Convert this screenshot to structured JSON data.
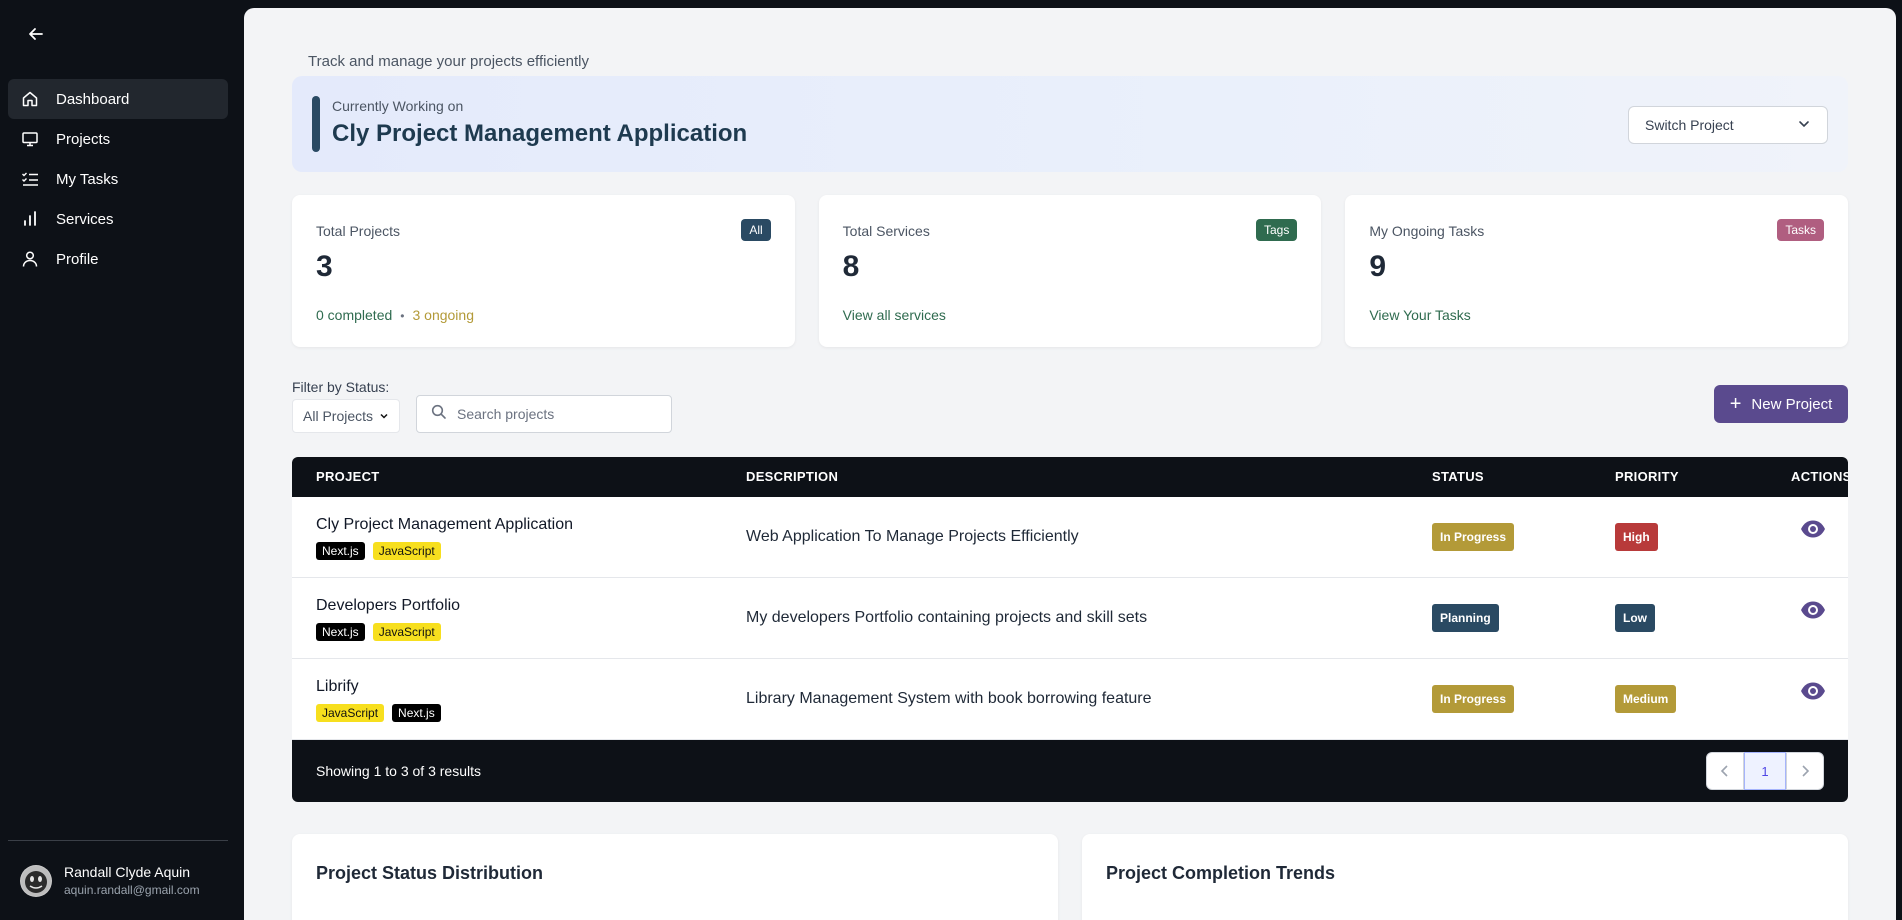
{
  "sidebar": {
    "items": [
      {
        "label": "Dashboard",
        "icon": "home-icon",
        "active": true
      },
      {
        "label": "Projects",
        "icon": "monitor-icon"
      },
      {
        "label": "My Tasks",
        "icon": "list-check-icon"
      },
      {
        "label": "Services",
        "icon": "bar-chart-icon"
      },
      {
        "label": "Profile",
        "icon": "user-icon"
      }
    ],
    "user": {
      "name": "Randall Clyde Aquin",
      "email": "aquin.randall@gmail.com"
    }
  },
  "header": {
    "subtitle": "Track and manage your projects efficiently",
    "current_label": "Currently Working on",
    "current_name": "Cly Project Management Application",
    "switch_label": "Switch Project"
  },
  "stats": [
    {
      "label": "Total Projects",
      "badge": "All",
      "badge_color": "#2a4a63",
      "value": "3",
      "foot_a": "0 completed",
      "foot_b": "3 ongoing"
    },
    {
      "label": "Total Services",
      "badge": "Tags",
      "badge_color": "#2f6b4f",
      "value": "8",
      "link": "View all services"
    },
    {
      "label": "My Ongoing Tasks",
      "badge": "Tasks",
      "badge_color": "#b05e80",
      "value": "9",
      "link": "View Your Tasks"
    }
  ],
  "filter": {
    "label": "Filter by Status:",
    "selected": "All Projects",
    "search_placeholder": "Search projects",
    "new_label": "New Project"
  },
  "table": {
    "headers": [
      "PROJECT",
      "DESCRIPTION",
      "STATUS",
      "PRIORITY",
      "ACTIONS"
    ],
    "rows": [
      {
        "name": "Cly Project Management Application",
        "tags": [
          "Next.js",
          "JavaScript"
        ],
        "desc": "Web Application To Manage Projects Efficiently",
        "status": "In Progress",
        "priority": "High"
      },
      {
        "name": "Developers Portfolio",
        "tags": [
          "Next.js",
          "JavaScript"
        ],
        "desc": "My developers Portfolio containing projects and skill sets",
        "status": "Planning",
        "priority": "Low"
      },
      {
        "name": "Librify",
        "tags": [
          "JavaScript",
          "Next.js"
        ],
        "desc": "Library Management System with book borrowing feature",
        "status": "In Progress",
        "priority": "Medium"
      }
    ],
    "showing": "Showing 1 to 3 of 3 results",
    "page": "1"
  },
  "panels": {
    "status_title": "Project Status Distribution",
    "trend_title": "Project Completion Trends"
  },
  "colors": {
    "in_progress": "#b39a38",
    "planning": "#2a4a63",
    "high": "#b83a3a",
    "low": "#2a4a63",
    "medium": "#b39a38",
    "completed_text": "#2f6b4f",
    "ongoing_text": "#b39a38",
    "link_text": "#2f6b4f",
    "accent": "#5a4a8e"
  }
}
